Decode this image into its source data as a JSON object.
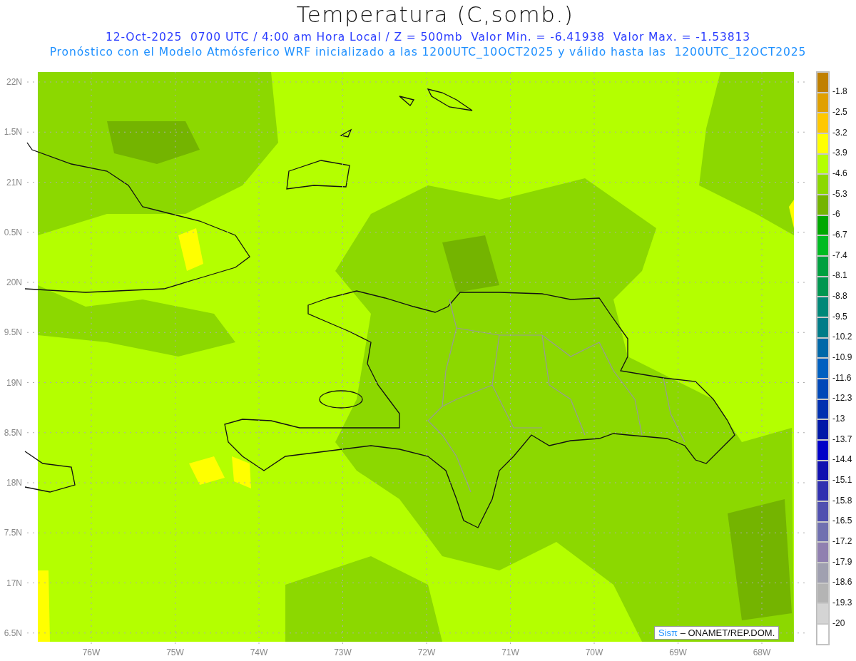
{
  "title": "Temperatura (C,somb.)",
  "subtitle_lines": [
    "12-Oct-2025  0700 UTC / 4:00 am Hora Local / Z = 500mb  Valor Min. = -6.41938  Valor Max. = -1.53813",
    "Pronóstico con el Modelo Atmósferico WRF inicializado a las 1200UTC_10OCT2025 y válido hasta las  1200UTC_12OCT2025"
  ],
  "latitude_labels": [
    "22N",
    "1.5N",
    "21N",
    "0.5N",
    "20N",
    "9.5N",
    "19N",
    "8.5N",
    "18N",
    "7.5N",
    "17N",
    "6.5N"
  ],
  "longitude_labels": [
    "76W",
    "75W",
    "74W",
    "73W",
    "72W",
    "71W",
    "70W",
    "69W",
    "68W"
  ],
  "colorbar": {
    "levels": [
      {
        "color": "#c08000"
      },
      {
        "color": "#e0a000"
      },
      {
        "color": "#ffc800"
      },
      {
        "color": "#ffff00"
      },
      {
        "color": "#b4ff00"
      },
      {
        "color": "#8cd800"
      },
      {
        "color": "#74b400"
      },
      {
        "color": "#00a800"
      },
      {
        "color": "#00bb22"
      },
      {
        "color": "#00a040"
      },
      {
        "color": "#009650"
      },
      {
        "color": "#008878"
      },
      {
        "color": "#007c88"
      },
      {
        "color": "#0068a8"
      },
      {
        "color": "#0060c0"
      },
      {
        "color": "#0048b8"
      },
      {
        "color": "#0030b0"
      },
      {
        "color": "#0018a8"
      },
      {
        "color": "#0000c8"
      },
      {
        "color": "#1010b0"
      },
      {
        "color": "#3030b0"
      },
      {
        "color": "#5050b0"
      },
      {
        "color": "#7070b0"
      },
      {
        "color": "#9080b0"
      },
      {
        "color": "#a0a0b0"
      },
      {
        "color": "#b4b4b4"
      },
      {
        "color": "#d4d4d4"
      },
      {
        "color": "#ffffff"
      }
    ],
    "labels": [
      "-1.8",
      "-2.5",
      "-3.2",
      "-3.9",
      "-4.6",
      "-5.3",
      "-6",
      "-6.7",
      "-7.4",
      "-8.1",
      "-8.8",
      "-9.5",
      "-10.2",
      "-10.9",
      "-11.6",
      "-12.3",
      "-13",
      "-13.7",
      "-14.4",
      "-15.1",
      "-15.8",
      "-16.5",
      "-17.2",
      "-17.9",
      "-18.6",
      "-19.3",
      "-20"
    ]
  },
  "credit": {
    "brand": "Sisπ",
    "text": "– ONAMET/REP.DOM."
  }
}
